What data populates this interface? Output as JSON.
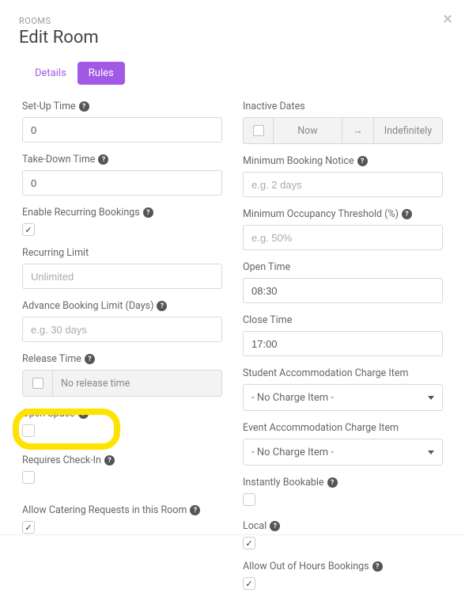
{
  "breadcrumb": "ROOMS",
  "title": "Edit Room",
  "tabs": {
    "details": "Details",
    "rules": "Rules"
  },
  "left": {
    "setup_time": {
      "label": "Set-Up Time",
      "value": "0"
    },
    "takedown_time": {
      "label": "Take-Down Time",
      "value": "0"
    },
    "enable_recurring": {
      "label": "Enable Recurring Bookings",
      "checked": "✓"
    },
    "recurring_limit": {
      "label": "Recurring Limit",
      "placeholder": "Unlimited"
    },
    "advance_limit": {
      "label": "Advance Booking Limit (Days)",
      "placeholder": "e.g. 30 days"
    },
    "release_time": {
      "label": "Release Time",
      "placeholder": "No release time"
    },
    "open_space": {
      "label": "Open Space",
      "checked": ""
    },
    "requires_checkin": {
      "label": "Requires Check-In",
      "checked": ""
    },
    "allow_catering": {
      "label": "Allow Catering Requests in this Room",
      "checked": "✓"
    }
  },
  "right": {
    "inactive_dates": {
      "label": "Inactive Dates",
      "now": "Now",
      "indef": "Indefinitely",
      "arrow": "→"
    },
    "min_notice": {
      "label": "Minimum Booking Notice",
      "placeholder": "e.g. 2 days"
    },
    "min_occupancy": {
      "label": "Minimum Occupancy Threshold (%)",
      "placeholder": "e.g. 50%"
    },
    "open_time": {
      "label": "Open Time",
      "value": "08:30"
    },
    "close_time": {
      "label": "Close Time",
      "value": "17:00"
    },
    "student_charge": {
      "label": "Student Accommodation Charge Item",
      "value": "- No Charge Item -"
    },
    "event_charge": {
      "label": "Event Accommodation Charge Item",
      "value": "- No Charge Item -"
    },
    "instantly_bookable": {
      "label": "Instantly Bookable",
      "checked": ""
    },
    "local": {
      "label": "Local",
      "checked": "✓"
    },
    "allow_ooh": {
      "label": "Allow Out of Hours Bookings",
      "checked": "✓"
    }
  }
}
